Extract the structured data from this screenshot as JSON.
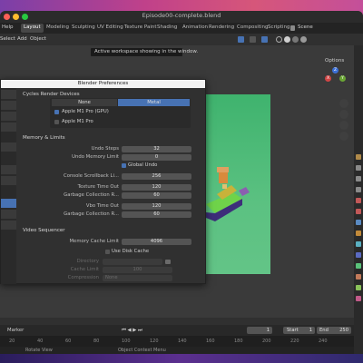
{
  "window": {
    "title": "Episode00-complete.blend"
  },
  "topbar": {
    "help": "Help",
    "workspaces": [
      "Layout",
      "Modeling",
      "Sculpting",
      "UV Editing",
      "Texture Paint",
      "Shading",
      "Animation",
      "Rendering",
      "Compositing",
      "Scripting"
    ],
    "active_workspace": "Layout",
    "scene": "Scene"
  },
  "header": {
    "select": "Select",
    "add": "Add",
    "object": "Object",
    "options": "Options"
  },
  "tooltip": "Active workspace showing in the window.",
  "gizmo": {
    "x": "X",
    "y": "Y",
    "z": "Z"
  },
  "prefs": {
    "title": "Blender Preferences",
    "cycles": {
      "heading": "Cycles Render Devices",
      "tabs": [
        "None",
        "Metal"
      ],
      "active_tab": "Metal",
      "devices": [
        {
          "label": "Apple M1 Pro (GPU)",
          "checked": true
        },
        {
          "label": "Apple M1 Pro",
          "checked": false
        }
      ]
    },
    "memory": {
      "heading": "Memory & Limits",
      "undo_steps": {
        "label": "Undo Steps",
        "value": "32"
      },
      "undo_memory": {
        "label": "Undo Memory Limit",
        "value": "0"
      },
      "global_undo": {
        "label": "Global Undo",
        "checked": true
      },
      "console": {
        "label": "Console Scrollback Li...",
        "value": "256"
      },
      "tex_timeout": {
        "label": "Texture Time Out",
        "value": "120"
      },
      "tex_gc": {
        "label": "Garbage Collection R...",
        "value": "60"
      },
      "vbo_timeout": {
        "label": "Vbo Time Out",
        "value": "120"
      },
      "vbo_gc": {
        "label": "Garbage Collection R...",
        "value": "60"
      }
    },
    "video": {
      "heading": "Video Sequencer",
      "cache_limit": {
        "label": "Memory Cache Limit",
        "value": "4096"
      },
      "disk_cache": {
        "label": "Use Disk Cache",
        "checked": false
      },
      "directory": {
        "label": "Directory",
        "value": ""
      },
      "disk_limit": {
        "label": "Cache Limit",
        "value": "100"
      },
      "compression": {
        "label": "Compression",
        "value": "None"
      }
    }
  },
  "timeline": {
    "marker": "Marker",
    "current_frame": "1",
    "start_label": "Start",
    "start": "1",
    "end_label": "End",
    "end": "250"
  },
  "ruler": [
    "20",
    "40",
    "60",
    "80",
    "100",
    "120",
    "140",
    "160",
    "180",
    "200",
    "220",
    "240"
  ],
  "status": {
    "rotate": "Rotate View",
    "context": "Object Context Menu"
  },
  "colors": {
    "accent": "#4772b3",
    "render_green": "#5bc181"
  }
}
